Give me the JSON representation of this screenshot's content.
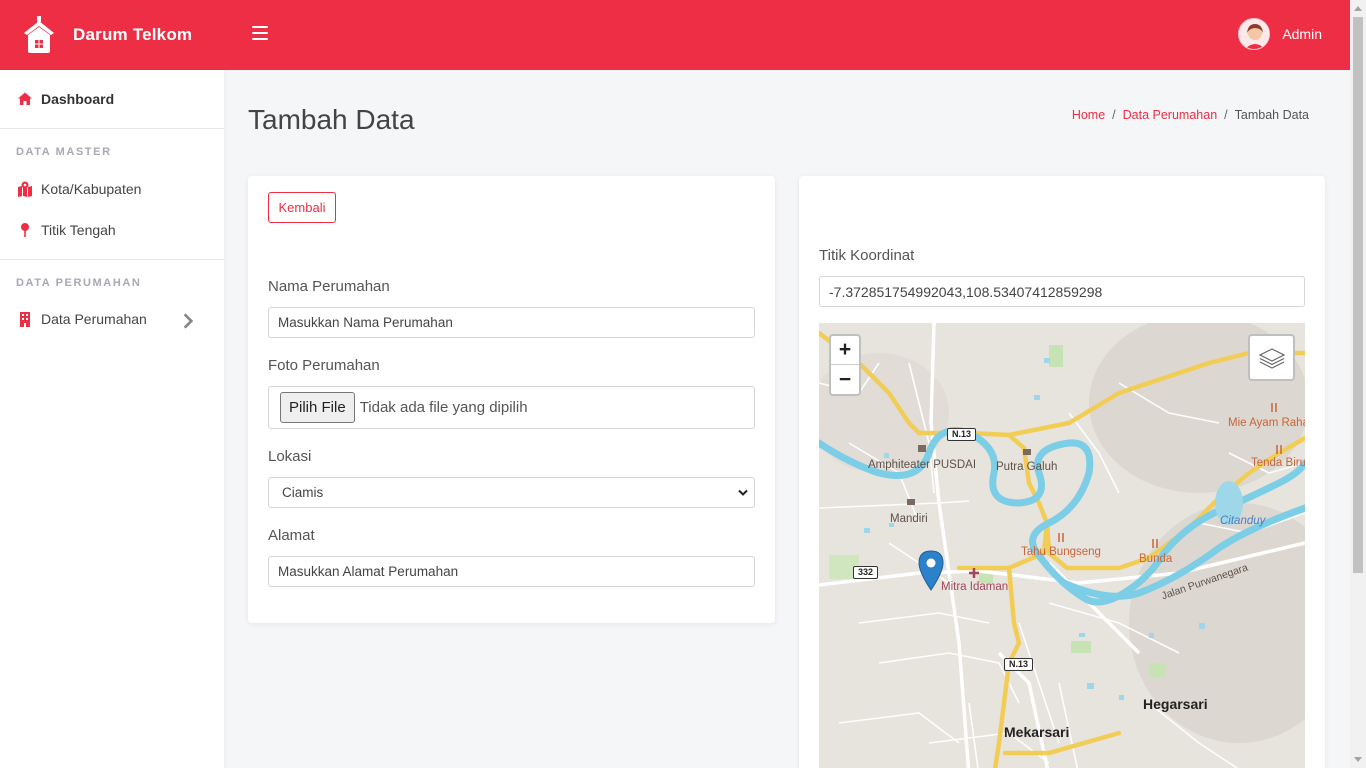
{
  "brand": {
    "name": "Darum Telkom"
  },
  "user": {
    "name": "Admin"
  },
  "sidebar": {
    "dashboard_label": "Dashboard",
    "section_master": "DATA MASTER",
    "master_items": [
      {
        "label": "Kota/Kabupaten"
      },
      {
        "label": "Titik Tengah"
      }
    ],
    "section_perumahan": "DATA PERUMAHAN",
    "perumahan_items": [
      {
        "label": "Data Perumahan"
      }
    ]
  },
  "page": {
    "title": "Tambah Data",
    "breadcrumb": [
      "Home",
      "Data Perumahan",
      "Tambah Data"
    ]
  },
  "form": {
    "back_label": "Kembali",
    "nama_label": "Nama Perumahan",
    "nama_placeholder": "Masukkan Nama Perumahan",
    "foto_label": "Foto Perumahan",
    "file_button": "Pilih File",
    "file_status": "Tidak ada file yang dipilih",
    "lokasi_label": "Lokasi",
    "lokasi_selected": "Ciamis",
    "alamat_label": "Alamat",
    "alamat_placeholder": "Masukkan Alamat Perumahan"
  },
  "map_panel": {
    "coord_label": "Titik Koordinat",
    "coord_value": "-7.372851754992043,108.53407412859298",
    "zoom_in": "+",
    "zoom_out": "−",
    "labels": {
      "amphitheater": "Amphiteater PUSDAI",
      "putra_galuh": "Putra Galuh",
      "mandiri": "Mandiri",
      "tahu_bungseng": "Tahu Bungseng",
      "bunda": "Bunda",
      "mitra_idaman": "Mitra Idaman",
      "mie_ayam": "Mie Ayam Raha",
      "tenda_biru": "Tenda Biru",
      "citanduy": "Citanduy",
      "jalan_purwanegara": "Jalan Purwanegara",
      "hegarsari": "Hegarsari",
      "mekarsari": "Mekarsari",
      "route_n13": "N.13",
      "route_332": "332"
    }
  },
  "colors": {
    "accent": "#ee2e45",
    "water": "#7ccde6",
    "road_major": "#f2cd56"
  }
}
